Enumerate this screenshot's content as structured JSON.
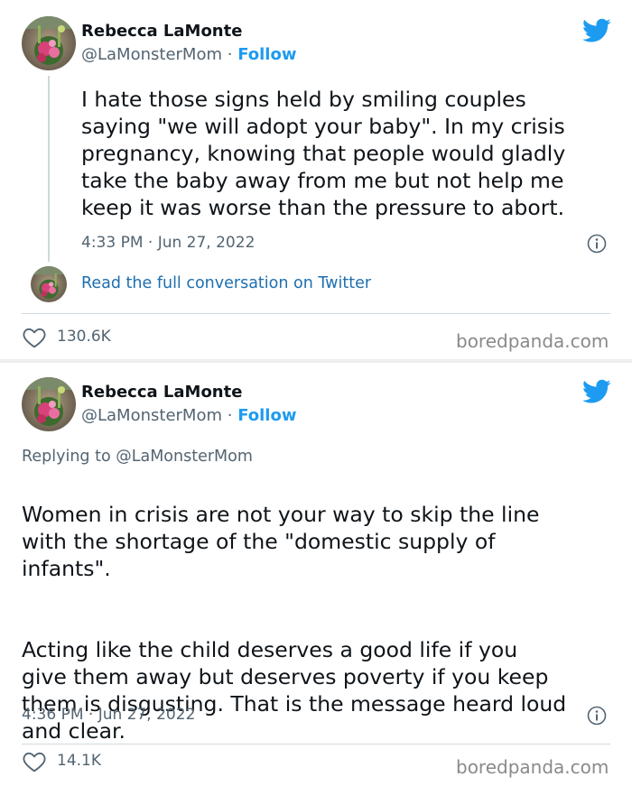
{
  "tweets": [
    {
      "display_name": "Rebecca LaMonte",
      "handle": "@LaMonsterMom",
      "separator": "·",
      "follow_label": "Follow",
      "text": "I hate those signs held by smiling couples\nsaying \"we will adopt your baby\". In my crisis\npregnancy, knowing that people would gladly\ntake the baby away from me but not help me\nkeep it was worse than the pressure to abort.",
      "timestamp": "4:33 PM · Jun 27, 2022",
      "read_full_label": "Read the full conversation on Twitter",
      "likes": "130.6K",
      "watermark": "boredpanda.com"
    },
    {
      "display_name": "Rebecca LaMonte",
      "handle": "@LaMonsterMom",
      "separator": "·",
      "follow_label": "Follow",
      "replying_prefix": "Replying to ",
      "replying_to": "@LaMonsterMom",
      "text_p1": "Women in crisis are not your way to skip the line\nwith the shortage of the \"domestic supply of\ninfants\".",
      "text_p2": "Acting like the child deserves a good life if you\ngive them away but deserves poverty if you keep\nthem is disgusting. That is the message heard loud\nand clear.",
      "timestamp": "4:36 PM · Jun 27, 2022",
      "likes": "14.1K",
      "watermark": "boredpanda.com"
    }
  ],
  "icons": {
    "brand": "twitter-bird-icon",
    "info": "info-icon",
    "like": "heart-icon",
    "avatar": "profile-photo-flowers"
  },
  "colors": {
    "twitter_blue": "#1d9bf0",
    "text": "#0f1419",
    "secondary_text": "#536471",
    "watermark": "#8a8a8a"
  }
}
